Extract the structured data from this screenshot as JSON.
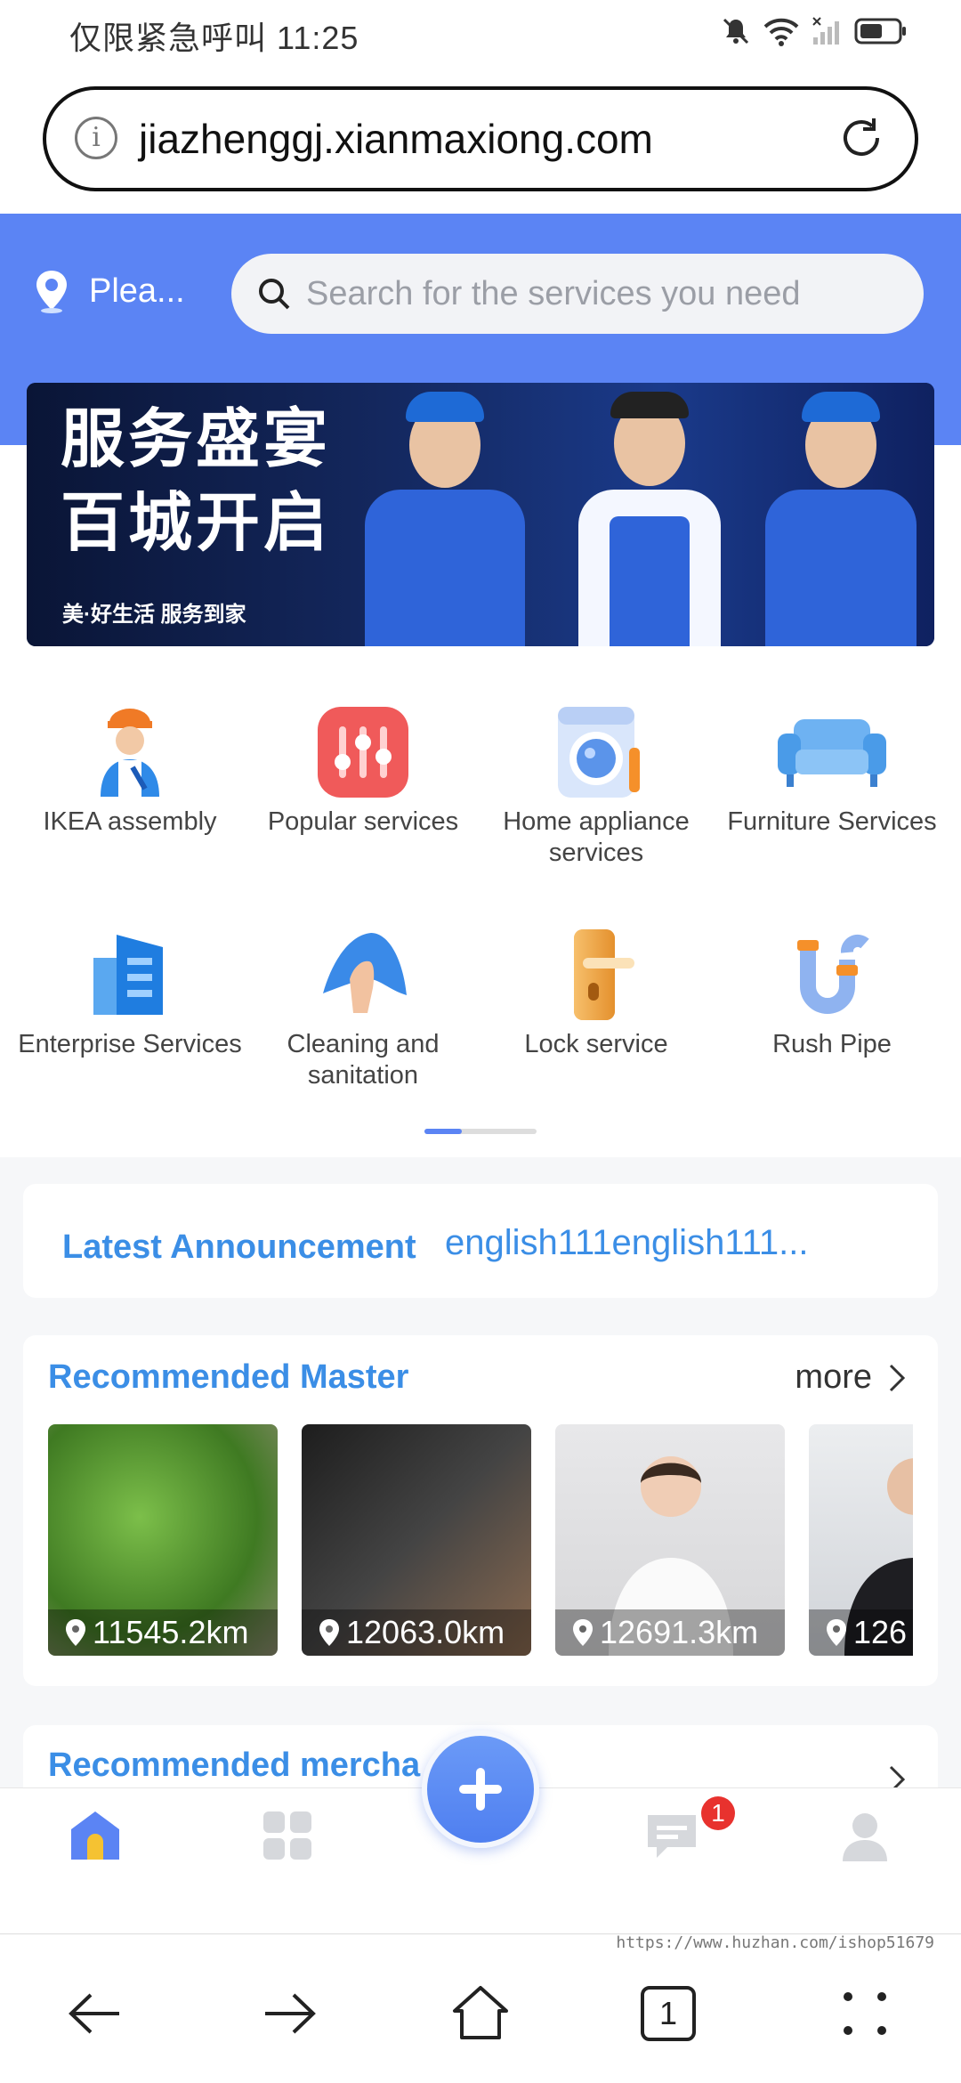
{
  "status_bar": {
    "carrier_time": "仅限紧急呼叫 11:25"
  },
  "url_bar": {
    "url": "jiazhenggj.xianmaxiong.com"
  },
  "header": {
    "location_label": "Plea...",
    "search_placeholder": "Search for the services you need"
  },
  "banner": {
    "title_line1": "服务盛宴",
    "title_line2": "百城开启",
    "subtitle": "美·好生活 服务到家"
  },
  "categories": [
    {
      "label": "IKEA assembly",
      "icon": "worker-icon"
    },
    {
      "label": "Popular services",
      "icon": "sliders-icon"
    },
    {
      "label": "Home appliance services",
      "icon": "washing-machine-icon"
    },
    {
      "label": "Furniture Services",
      "icon": "sofa-icon"
    },
    {
      "label": "Enterprise Services",
      "icon": "building-icon"
    },
    {
      "label": "Cleaning and sanitation",
      "icon": "cleaning-cloth-icon"
    },
    {
      "label": "Lock service",
      "icon": "door-lock-icon"
    },
    {
      "label": "Rush Pipe",
      "icon": "pipe-icon"
    }
  ],
  "announcement": {
    "title": "Latest Announcement",
    "text": "english111english111..."
  },
  "recommended_master": {
    "title": "Recommended Master",
    "more": "more",
    "items": [
      {
        "distance": "11545.2km"
      },
      {
        "distance": "12063.0km"
      },
      {
        "distance": "12691.3km"
      },
      {
        "distance": "126"
      }
    ]
  },
  "recommended_merchant": {
    "title": "Recommended mercha"
  },
  "tabbar": {
    "badge": "1"
  },
  "watermark": "https://www.huzhan.com/ishop51679",
  "browser_nav": {
    "tab_count": "1"
  },
  "colors": {
    "primary": "#5b84f4",
    "accent_text": "#3b8ee6",
    "badge": "#e8322e"
  }
}
